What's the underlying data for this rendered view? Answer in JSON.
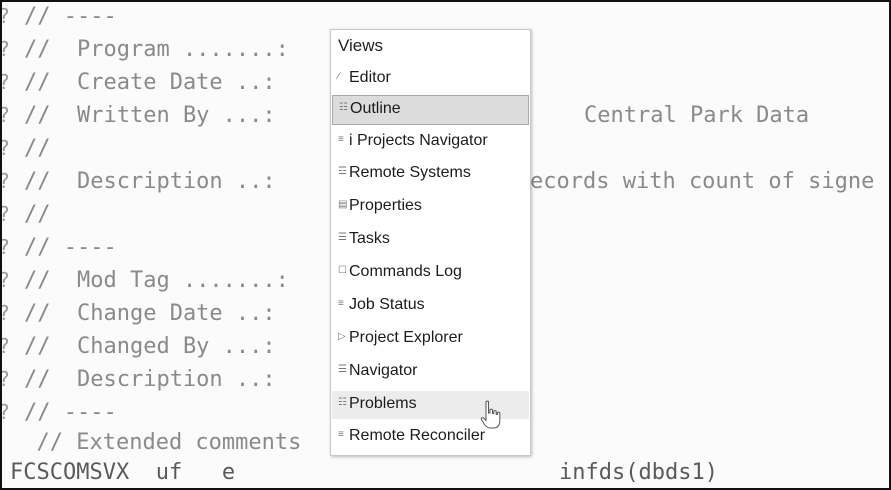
{
  "editor": {
    "lines": [
      {
        "marker": "?",
        "text": "// ----"
      },
      {
        "marker": "?",
        "text": "//  Program .......:"
      },
      {
        "marker": "?",
        "text": "//  Create Date ..:"
      },
      {
        "marker": "?",
        "text": "//  Written By ...:"
      },
      {
        "marker": "?",
        "text": "//"
      },
      {
        "marker": "?",
        "text": "//  Description ..:"
      },
      {
        "marker": "?",
        "text": "//"
      },
      {
        "marker": "?",
        "text": "// ----"
      },
      {
        "marker": "?",
        "text": "//  Mod Tag .......:"
      },
      {
        "marker": "?",
        "text": "//  Change Date ..:"
      },
      {
        "marker": "?",
        "text": "//  Changed By ...:"
      },
      {
        "marker": "?",
        "text": "//  Description ..:"
      },
      {
        "marker": "?",
        "text": "// ----"
      },
      {
        "marker": "",
        "text": "  // Extended comments"
      }
    ],
    "written_by_value": "Central Park Data",
    "description_value": "ecords with count of signe",
    "bottom_left": "FCSCOMSVX  uf   e",
    "bottom_right": "infds(dbds1)"
  },
  "popup": {
    "title": "Views",
    "items": [
      {
        "label": "Editor",
        "icon": "pencil-icon",
        "glyph": "∕"
      },
      {
        "label": "Outline",
        "icon": "outline-icon",
        "glyph": "☷"
      },
      {
        "label": "i Projects Navigator",
        "icon": "projects-navigator-icon",
        "glyph": "≡"
      },
      {
        "label": "Remote Systems",
        "icon": "remote-systems-icon",
        "glyph": "☲"
      },
      {
        "label": "Properties",
        "icon": "properties-icon",
        "glyph": "▤"
      },
      {
        "label": "Tasks",
        "icon": "tasks-icon",
        "glyph": "☰"
      },
      {
        "label": "Commands Log",
        "icon": "commands-log-icon",
        "glyph": "☐"
      },
      {
        "label": "Job Status",
        "icon": "job-status-icon",
        "glyph": "≡"
      },
      {
        "label": "Project Explorer",
        "icon": "project-explorer-icon",
        "glyph": "▷"
      },
      {
        "label": "Navigator",
        "icon": "navigator-icon",
        "glyph": "☰"
      },
      {
        "label": "Problems",
        "icon": "problems-icon",
        "glyph": "☷"
      },
      {
        "label": "Remote Reconciler",
        "icon": "remote-reconciler-icon",
        "glyph": "≡"
      }
    ],
    "selected_item": "Outline",
    "hover_item": "Problems"
  }
}
